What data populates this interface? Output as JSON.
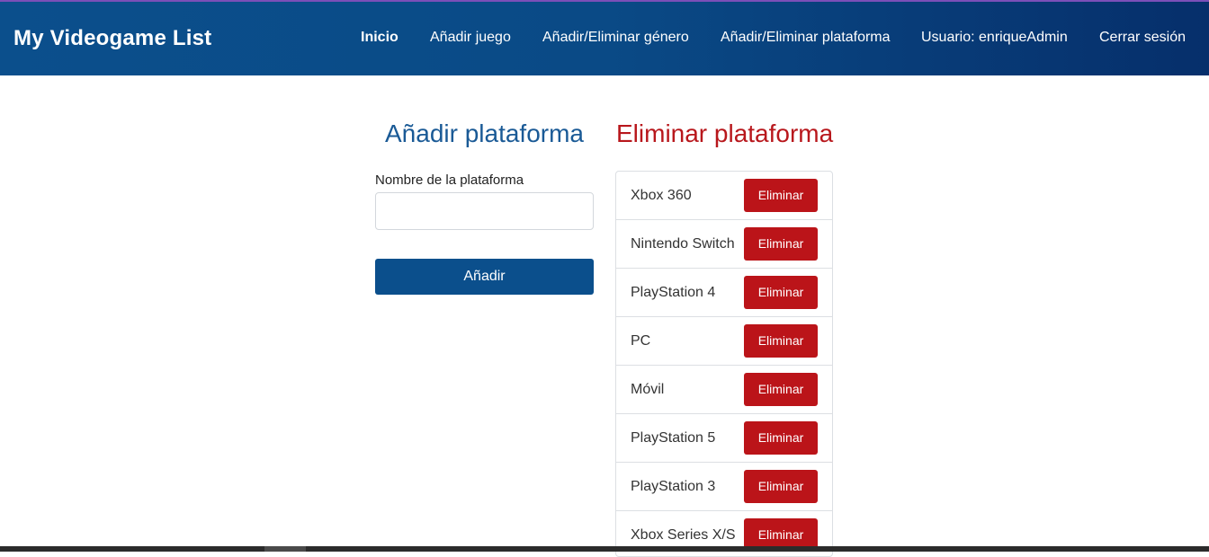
{
  "navbar": {
    "brand": "My Videogame List",
    "links": [
      {
        "label": "Inicio",
        "active": true
      },
      {
        "label": "Añadir juego"
      },
      {
        "label": "Añadir/Eliminar género"
      },
      {
        "label": "Añadir/Eliminar plataforma"
      },
      {
        "label": "Usuario: enriqueAdmin"
      },
      {
        "label": "Cerrar sesión"
      }
    ]
  },
  "add_section": {
    "title": "Añadir plataforma",
    "field_label": "Nombre de la plataforma",
    "input_value": "",
    "submit_label": "Añadir"
  },
  "delete_section": {
    "title": "Eliminar plataforma",
    "platforms": [
      {
        "name": "Xbox 360",
        "action": "Eliminar"
      },
      {
        "name": "Nintendo Switch",
        "action": "Eliminar"
      },
      {
        "name": "PlayStation 4",
        "action": "Eliminar"
      },
      {
        "name": "PC",
        "action": "Eliminar"
      },
      {
        "name": "Móvil",
        "action": "Eliminar"
      },
      {
        "name": "PlayStation 5",
        "action": "Eliminar"
      },
      {
        "name": "PlayStation 3",
        "action": "Eliminar"
      },
      {
        "name": "Xbox Series X/S",
        "action": "Eliminar"
      }
    ]
  },
  "colors": {
    "navbar": "#0b4f8c",
    "add_accent": "#1a5a96",
    "delete_accent": "#b8171c"
  }
}
